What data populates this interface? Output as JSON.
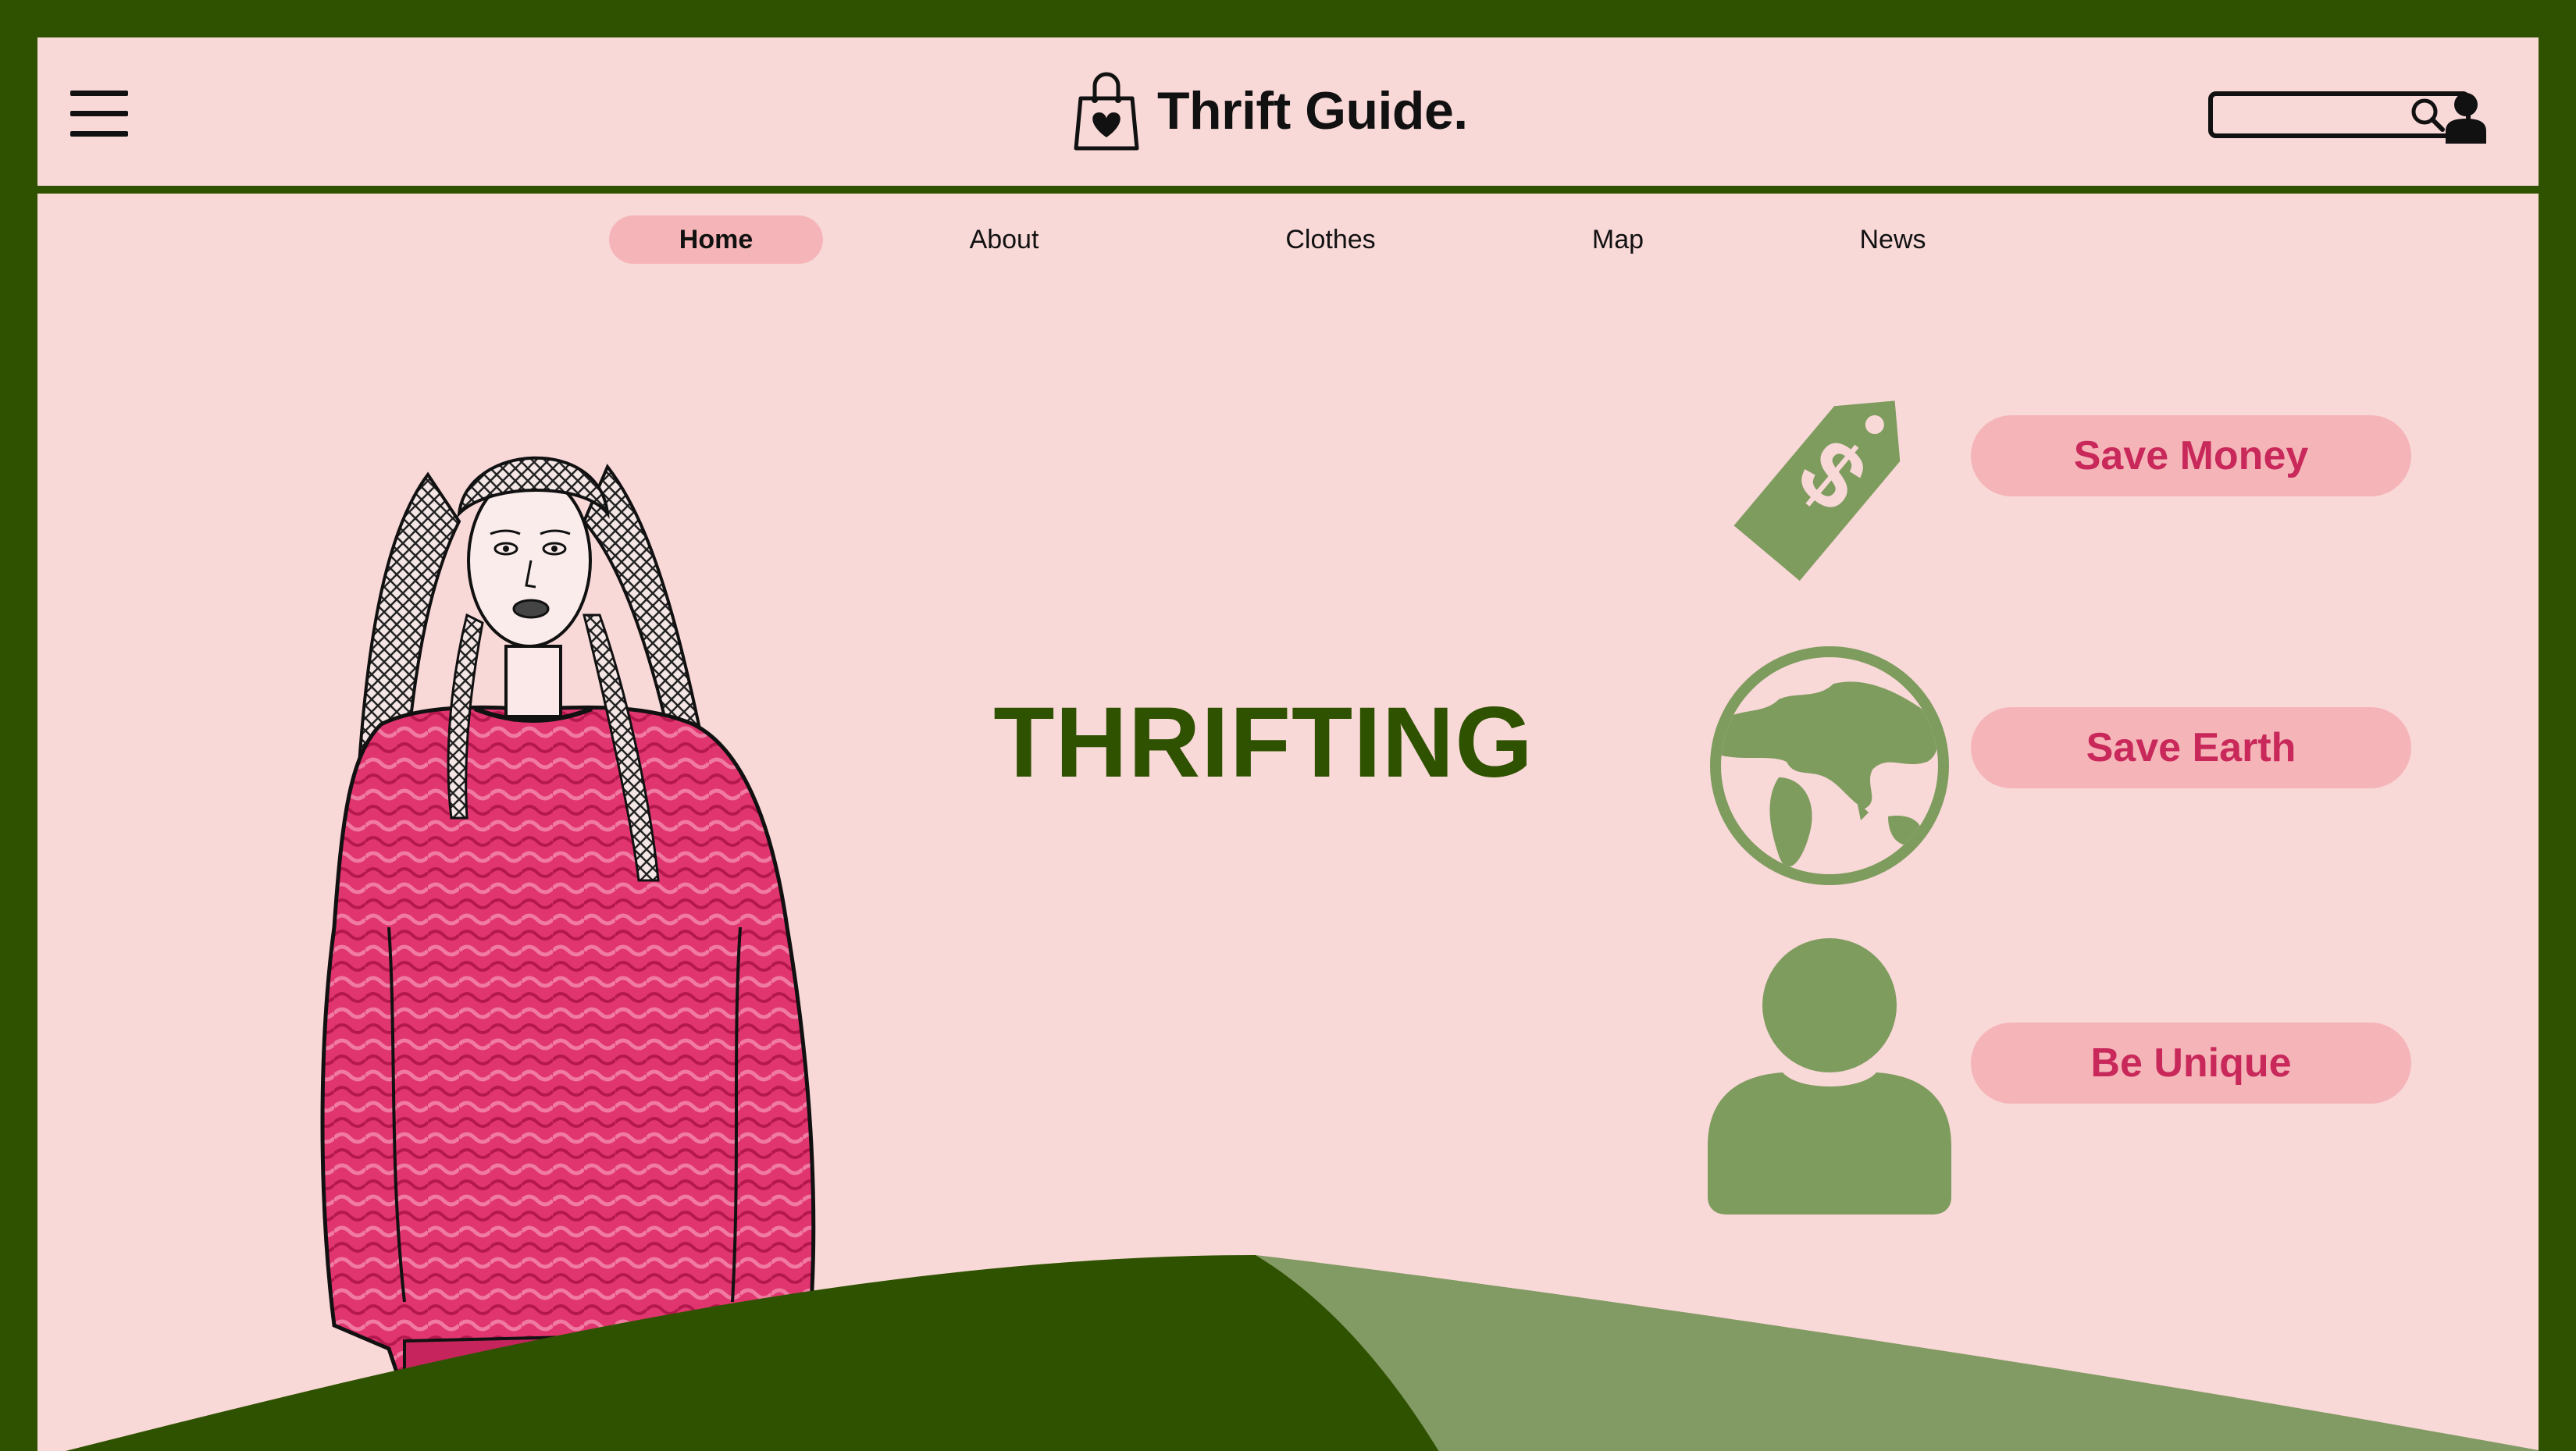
{
  "header": {
    "brand_title": "Thrift Guide.",
    "search": {
      "value": "",
      "placeholder": ""
    }
  },
  "nav": {
    "items": [
      {
        "label": "Home",
        "active": true
      },
      {
        "label": "About",
        "active": false
      },
      {
        "label": "Clothes",
        "active": false
      },
      {
        "label": "Map",
        "active": false
      },
      {
        "label": "News",
        "active": false
      }
    ]
  },
  "hero": {
    "title": "THRIFTING"
  },
  "features": [
    {
      "label": "Save Money",
      "icon": "price-tag-icon"
    },
    {
      "label": "Save Earth",
      "icon": "globe-icon"
    },
    {
      "label": "Be Unique",
      "icon": "person-icon"
    }
  ],
  "colors": {
    "primary_green": "#2f5200",
    "light_green": "#829a63",
    "background_pink": "#f9d8d8",
    "button_pink": "#f5b5b8",
    "accent_magenta": "#c8285a",
    "sweater_pink": "#e0356f"
  }
}
